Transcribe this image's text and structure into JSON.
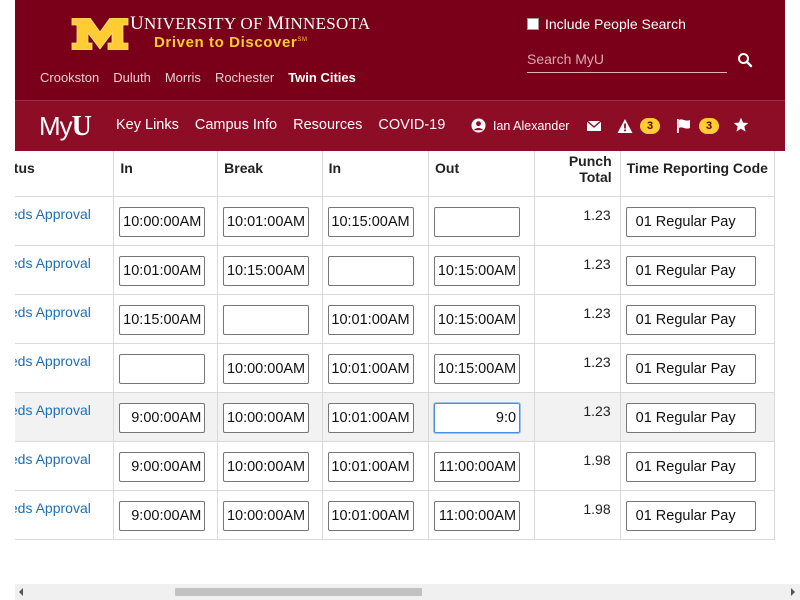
{
  "header": {
    "university_prefix": "U",
    "university_rest": "NIVERSITY OF ",
    "university_m": "M",
    "university_rest2": "INNESOTA",
    "tagline": "Driven to Discover",
    "tagline_mark": "SM",
    "campuses": [
      "Crookston",
      "Duluth",
      "Morris",
      "Rochester",
      "Twin Cities"
    ],
    "active_campus": "Twin Cities",
    "people_search_label": "Include People Search",
    "search_placeholder": "Search MyU",
    "brand_color": "#7a0019",
    "gold_color": "#ffcc33"
  },
  "nav": {
    "logo_my": "My",
    "logo_u": "U",
    "links": [
      "Key Links",
      "Campus Info",
      "Resources",
      "COVID-19"
    ],
    "user_name": "Ian Alexander",
    "alerts_count": "3",
    "flags_count": "3",
    "icons": [
      "user-icon",
      "envelope-icon",
      "warning-icon",
      "flag-icon",
      "star-icon"
    ]
  },
  "table": {
    "headers": {
      "status": "Status",
      "in1": "In",
      "break": "Break",
      "in2": "In",
      "out": "Out",
      "punch_line1": "Punch",
      "punch_line2": "Total",
      "trc": "Time Reporting Code"
    },
    "rows": [
      {
        "status": "Needs Approval",
        "in1": "10:00:00AM",
        "brk": "10:01:00AM",
        "in2": "10:15:00AM",
        "out": "",
        "total": "1.23",
        "trc": "01 Regular Pay"
      },
      {
        "status": "Needs Approval",
        "in1": "10:01:00AM",
        "brk": "10:15:00AM",
        "in2": "",
        "out": "10:15:00AM",
        "total": "1.23",
        "trc": "01 Regular Pay"
      },
      {
        "status": "Needs Approval",
        "in1": "10:15:00AM",
        "brk": "",
        "in2": "10:01:00AM",
        "out": "10:15:00AM",
        "total": "1.23",
        "trc": "01 Regular Pay"
      },
      {
        "status": "Needs Approval",
        "in1": "",
        "brk": "10:00:00AM",
        "in2": "10:01:00AM",
        "out": "10:15:00AM",
        "total": "1.23",
        "trc": "01 Regular Pay"
      },
      {
        "status": "Needs Approval",
        "in1": "9:00:00AM",
        "brk": "10:00:00AM",
        "in2": "10:01:00AM",
        "out": "9:0",
        "total": "1.23",
        "trc": "01 Regular Pay"
      },
      {
        "status": "Needs Approval",
        "in1": "9:00:00AM",
        "brk": "10:00:00AM",
        "in2": "10:01:00AM",
        "out": "11:00:00AM",
        "total": "1.98",
        "trc": "01 Regular Pay"
      },
      {
        "status": "Needs Approval",
        "in1": "9:00:00AM",
        "brk": "10:00:00AM",
        "in2": "10:01:00AM",
        "out": "11:00:00AM",
        "total": "1.98",
        "trc": "01 Regular Pay"
      }
    ],
    "highlighted_row": 4,
    "focused_cell": "out"
  }
}
